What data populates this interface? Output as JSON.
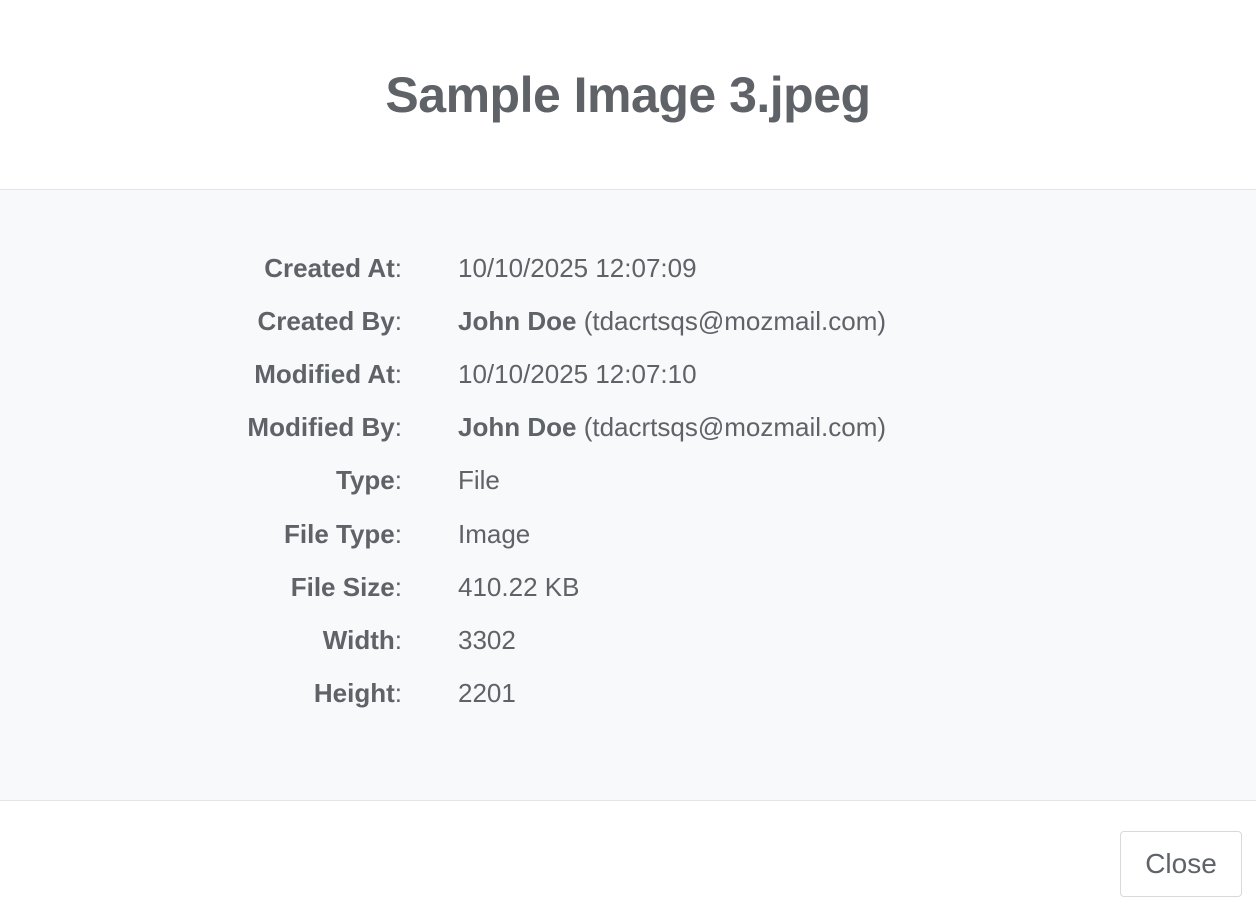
{
  "dialog": {
    "title": "Sample Image 3.jpeg",
    "close_label": "Close"
  },
  "details": [
    {
      "label": "Created At",
      "value": "10/10/2025 12:07:09"
    },
    {
      "label": "Created By",
      "name": "John Doe",
      "email": "(tdacrtsqs@mozmail.com)"
    },
    {
      "label": "Modified At",
      "value": "10/10/2025 12:07:10"
    },
    {
      "label": "Modified By",
      "name": "John Doe",
      "email": "(tdacrtsqs@mozmail.com)"
    },
    {
      "label": "Type",
      "value": "File"
    },
    {
      "label": "File Type",
      "value": "Image"
    },
    {
      "label": "File Size",
      "value": "410.22 KB"
    },
    {
      "label": "Width",
      "value": "3302"
    },
    {
      "label": "Height",
      "value": "2201"
    }
  ]
}
